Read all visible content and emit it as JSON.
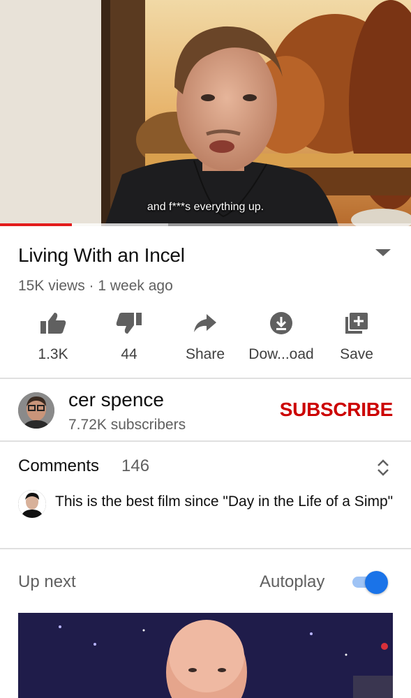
{
  "player": {
    "caption": "and f***s everything up.",
    "progress_fraction": 0.175,
    "buffered_fraction": 0.41,
    "colors": {
      "progress": "#e31c1c"
    }
  },
  "video": {
    "title": "Living With an Incel",
    "meta": "15K views · 1 week ago"
  },
  "actions": [
    {
      "icon": "thumbs-up-icon",
      "label": "1.3K"
    },
    {
      "icon": "thumbs-down-icon",
      "label": "44"
    },
    {
      "icon": "share-icon",
      "label": "Share"
    },
    {
      "icon": "download-icon",
      "label": "Dow...oad"
    },
    {
      "icon": "save-playlist-icon",
      "label": "Save"
    }
  ],
  "channel": {
    "name": "cer spence",
    "subscribers": "7.72K subscribers",
    "subscribe_label": "SUBSCRIBE",
    "colors": {
      "subscribe": "#cc0000"
    }
  },
  "comments": {
    "title": "Comments",
    "count": "146",
    "top_comment": "This is the best film since \"Day in the Life of a Simp\""
  },
  "up_next": {
    "label": "Up next",
    "autoplay_label": "Autoplay",
    "autoplay_on": true,
    "colors": {
      "toggle": "#1a73e8"
    }
  }
}
